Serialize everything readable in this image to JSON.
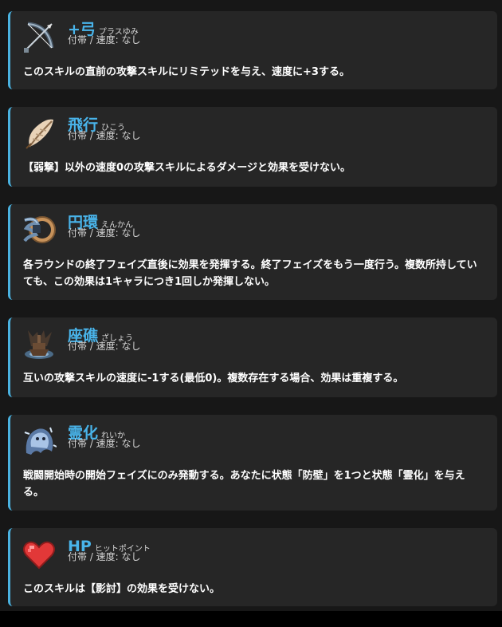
{
  "skills": [
    {
      "name": "+弓",
      "ruby": "プラスゆみ",
      "meta": "付帯 / 速度: なし",
      "icon": "bow-icon",
      "description": "このスキルの直前の攻撃スキルにリミテッドを与え、速度に+3する。"
    },
    {
      "name": "飛行",
      "ruby": "ひこう",
      "meta": "付帯 / 速度: なし",
      "icon": "feather-icon",
      "description": "【弱撃】以外の速度0の攻撃スキルによるダメージと効果を受けない。"
    },
    {
      "name": "円環",
      "ruby": "えんかん",
      "meta": "付帯 / 速度: なし",
      "icon": "ring-icon",
      "description": "各ラウンドの終了フェイズ直後に効果を発揮する。終了フェイズをもう一度行う。複数所持していても、この効果は1キャラにつき1回しか発揮しない。"
    },
    {
      "name": "座礁",
      "ruby": "ざしょう",
      "meta": "付帯 / 速度: なし",
      "icon": "stranded-ship-icon",
      "description": "互いの攻撃スキルの速度に-1する(最低0)。複数存在する場合、効果は重複する。"
    },
    {
      "name": "霊化",
      "ruby": "れいか",
      "meta": "付帯 / 速度: なし",
      "icon": "ghost-icon",
      "description": "戦闘開始時の開始フェイズにのみ発動する。あなたに状態「防壁」を1つと状態「霊化」を与える。"
    },
    {
      "name": "HP",
      "ruby": "ヒットポイント",
      "meta": "付帯 / 速度: なし",
      "icon": "heart-icon",
      "description": "このスキルは【影討】の効果を受けない。"
    }
  ],
  "colors": {
    "accent": "#4ab2e0",
    "title": "#49b4ea",
    "card": "#262626",
    "background": "#171717"
  }
}
